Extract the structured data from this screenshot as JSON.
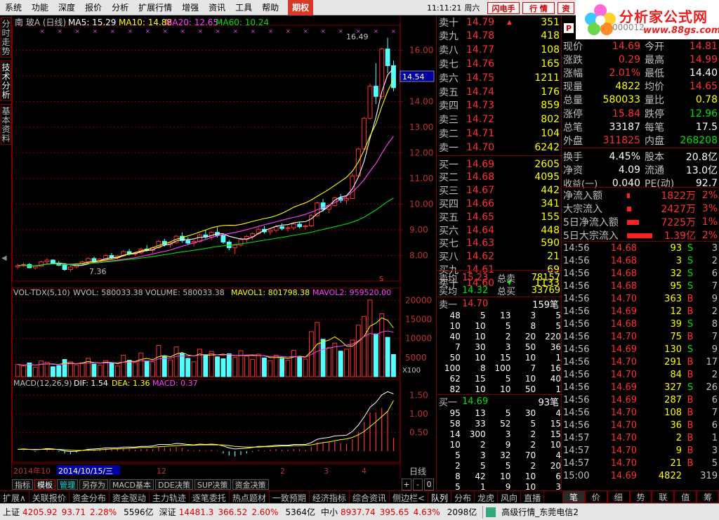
{
  "menubar": {
    "items": [
      "系统",
      "功能",
      "深度",
      "报价",
      "分析",
      "扩展行情",
      "增强",
      "资讯",
      "工具",
      "帮助"
    ],
    "highlight": "期权",
    "time": "11:11:21",
    "weekday": "周六",
    "btn_flash": "闪电手",
    "btn_quote": "行 情",
    "btn_info": "资"
  },
  "logo": {
    "title": "分析家公式网",
    "url": "www.88gs.com",
    "flag": "P",
    "code": "000012"
  },
  "sidebar": {
    "tabs": [
      "分时走势",
      "技术分析",
      "基本资料"
    ]
  },
  "chart": {
    "header": {
      "name": "南 玻A (日线)",
      "ma5": "MA5: 15.29",
      "ma10": "MA10: 14.88",
      "ma20": "MA20: 12.65",
      "ma60": "MA60: 10.24"
    },
    "vol_header": {
      "name": "VOL-TDX(5,10)",
      "wvol": "WVOL: 580033.38",
      "volume": "VOLUME: 580033.38",
      "mavol1": "MAVOL1: 801798.38",
      "mavol2": "MAVOL2: 959520.00"
    },
    "macd_header": {
      "name": "MACD(12,26,9)",
      "dif": "DIF: 1.54",
      "dea": "DEA: 1.36",
      "macd": "MACD: 0.37"
    },
    "price_ticks": [
      "16.00",
      "15.00",
      "14.00",
      "13.00",
      "12.00",
      "11.00",
      "10.00",
      "9.00",
      "8.00"
    ],
    "vol_ticks": [
      "20000",
      "15000",
      "10000",
      "5000"
    ],
    "macd_ticks": [
      "1.50",
      "1.00",
      "0.50"
    ],
    "current_price": "14.54",
    "high_label": "16.49",
    "low_label": "7.36",
    "vol_unit": "X100",
    "date_labels": [
      "2014年10",
      "2014/10/15/三",
      "12",
      "2",
      "3",
      "4"
    ],
    "period": "日线",
    "s_mark": "S"
  },
  "chart_data": {
    "type": "candlestick",
    "price_range": [
      7.0,
      16.7
    ],
    "candles": [
      [
        7.55,
        7.68,
        7.48,
        7.6
      ],
      [
        7.6,
        7.72,
        7.55,
        7.65
      ],
      [
        7.65,
        7.7,
        7.5,
        7.52
      ],
      [
        7.52,
        7.62,
        7.45,
        7.58
      ],
      [
        7.58,
        7.8,
        7.55,
        7.75
      ],
      [
        7.75,
        7.9,
        7.68,
        7.82
      ],
      [
        7.82,
        7.85,
        7.65,
        7.7
      ],
      [
        7.7,
        7.78,
        7.58,
        7.62
      ],
      [
        7.62,
        7.7,
        7.4,
        7.45
      ],
      [
        7.45,
        7.6,
        7.36,
        7.55
      ],
      [
        7.55,
        7.7,
        7.5,
        7.66
      ],
      [
        7.66,
        7.8,
        7.6,
        7.75
      ],
      [
        7.75,
        7.92,
        7.7,
        7.88
      ],
      [
        7.88,
        7.95,
        7.72,
        7.78
      ],
      [
        7.78,
        7.9,
        7.74,
        7.86
      ],
      [
        7.86,
        8.05,
        7.82,
        8.0
      ],
      [
        8.0,
        8.1,
        7.86,
        7.92
      ],
      [
        7.92,
        8.02,
        7.85,
        7.98
      ],
      [
        7.98,
        8.2,
        7.95,
        8.15
      ],
      [
        8.15,
        8.25,
        8.0,
        8.05
      ],
      [
        8.05,
        8.15,
        7.98,
        8.1
      ],
      [
        8.1,
        8.3,
        8.05,
        8.25
      ],
      [
        8.25,
        8.4,
        8.15,
        8.2
      ],
      [
        8.2,
        8.35,
        8.1,
        8.3
      ],
      [
        8.3,
        8.6,
        8.25,
        8.55
      ],
      [
        8.55,
        8.65,
        8.35,
        8.42
      ],
      [
        8.42,
        8.55,
        8.3,
        8.5
      ],
      [
        8.5,
        8.8,
        8.45,
        8.75
      ],
      [
        8.75,
        8.9,
        8.5,
        8.58
      ],
      [
        8.58,
        8.7,
        8.4,
        8.48
      ],
      [
        8.48,
        8.62,
        8.35,
        8.55
      ],
      [
        8.55,
        8.85,
        8.5,
        8.8
      ],
      [
        8.8,
        9.0,
        8.65,
        8.72
      ],
      [
        8.72,
        8.95,
        8.6,
        8.9
      ],
      [
        8.9,
        9.1,
        8.7,
        8.78
      ],
      [
        8.78,
        8.85,
        8.45,
        8.52
      ],
      [
        8.52,
        8.6,
        8.2,
        8.3
      ],
      [
        8.3,
        8.45,
        8.05,
        8.4
      ],
      [
        8.4,
        8.7,
        8.35,
        8.62
      ],
      [
        8.62,
        8.8,
        8.5,
        8.74
      ],
      [
        8.74,
        8.9,
        8.6,
        8.85
      ],
      [
        8.85,
        9.1,
        8.8,
        9.02
      ],
      [
        9.02,
        9.15,
        8.85,
        8.92
      ],
      [
        8.92,
        9.05,
        8.8,
        8.98
      ],
      [
        8.98,
        9.2,
        8.9,
        9.12
      ],
      [
        9.12,
        9.25,
        8.98,
        9.05
      ],
      [
        9.05,
        9.15,
        8.92,
        9.08
      ],
      [
        9.08,
        9.3,
        9.0,
        9.22
      ],
      [
        9.22,
        9.3,
        9.05,
        9.12
      ],
      [
        9.12,
        9.2,
        9.0,
        9.15
      ],
      [
        9.15,
        9.6,
        9.1,
        9.55
      ],
      [
        9.55,
        10.1,
        9.5,
        10.05
      ],
      [
        10.05,
        10.2,
        9.7,
        9.8
      ],
      [
        9.8,
        10.0,
        9.65,
        9.95
      ],
      [
        9.95,
        10.3,
        9.9,
        10.25
      ],
      [
        10.25,
        10.4,
        10.05,
        10.15
      ],
      [
        10.15,
        10.3,
        10.0,
        10.22
      ],
      [
        10.22,
        11.2,
        10.2,
        11.1
      ],
      [
        11.1,
        12.2,
        11.05,
        12.15
      ],
      [
        12.15,
        13.4,
        12.1,
        13.35
      ],
      [
        13.35,
        14.7,
        13.3,
        14.6
      ],
      [
        14.6,
        15.5,
        13.9,
        14.2
      ],
      [
        14.2,
        16.1,
        14.1,
        16.05
      ],
      [
        16.05,
        16.49,
        15.1,
        15.4
      ],
      [
        15.4,
        15.6,
        14.4,
        14.54
      ]
    ],
    "ma_series": [
      {
        "name": "MA5",
        "value": 15.29,
        "color": "#ffffff"
      },
      {
        "name": "MA10",
        "value": 14.88,
        "color": "#ffff00"
      },
      {
        "name": "MA20",
        "value": 12.65,
        "color": "#ff40ff"
      },
      {
        "name": "MA60",
        "value": 10.24,
        "color": "#00e000"
      }
    ],
    "vol_range": [
      0,
      21000
    ],
    "volume": [
      3200,
      2800,
      3600,
      2500,
      4100,
      3800,
      2600,
      2900,
      4500,
      3900,
      3100,
      3600,
      4800,
      3300,
      3000,
      4200,
      3500,
      2800,
      5600,
      4300,
      3700,
      6200,
      4100,
      3900,
      8200,
      5300,
      4400,
      7800,
      6100,
      4800,
      3900,
      7200,
      5800,
      6600,
      5200,
      4700,
      6000,
      5100,
      6800,
      5400,
      4500,
      5900,
      4900,
      4200,
      5600,
      4800,
      4300,
      6900,
      5200,
      4600,
      11800,
      14200,
      9800,
      7600,
      8800,
      6700,
      7200,
      9600,
      13500,
      15800,
      20100,
      11200,
      16500,
      10300,
      5800
    ],
    "macd_range": [
      -0.3,
      1.7
    ],
    "dif": [
      0.05,
      0.06,
      0.05,
      0.04,
      0.05,
      0.07,
      0.06,
      0.04,
      0.01,
      -0.01,
      0.0,
      0.02,
      0.05,
      0.06,
      0.07,
      0.09,
      0.09,
      0.09,
      0.11,
      0.11,
      0.11,
      0.13,
      0.13,
      0.14,
      0.18,
      0.18,
      0.18,
      0.21,
      0.2,
      0.18,
      0.17,
      0.19,
      0.18,
      0.19,
      0.18,
      0.14,
      0.09,
      0.06,
      0.07,
      0.08,
      0.1,
      0.13,
      0.13,
      0.14,
      0.16,
      0.16,
      0.16,
      0.18,
      0.18,
      0.18,
      0.23,
      0.32,
      0.35,
      0.37,
      0.41,
      0.42,
      0.43,
      0.53,
      0.7,
      0.92,
      1.18,
      1.31,
      1.51,
      1.6,
      1.54
    ],
    "dea": [
      0.05,
      0.05,
      0.05,
      0.05,
      0.05,
      0.05,
      0.05,
      0.05,
      0.04,
      0.03,
      0.02,
      0.02,
      0.03,
      0.03,
      0.04,
      0.05,
      0.06,
      0.06,
      0.07,
      0.08,
      0.09,
      0.1,
      0.1,
      0.11,
      0.12,
      0.13,
      0.14,
      0.15,
      0.16,
      0.16,
      0.16,
      0.17,
      0.17,
      0.17,
      0.17,
      0.17,
      0.15,
      0.13,
      0.12,
      0.11,
      0.11,
      0.11,
      0.12,
      0.12,
      0.13,
      0.14,
      0.14,
      0.15,
      0.15,
      0.16,
      0.17,
      0.2,
      0.23,
      0.25,
      0.28,
      0.31,
      0.33,
      0.37,
      0.44,
      0.53,
      0.66,
      0.79,
      0.93,
      1.07,
      1.36
    ]
  },
  "orderbook": {
    "sell": [
      [
        "卖十",
        "14.79",
        "351",
        "up"
      ],
      [
        "卖九",
        "14.78",
        "418",
        ""
      ],
      [
        "卖八",
        "14.77",
        "108",
        ""
      ],
      [
        "卖七",
        "14.76",
        "165",
        ""
      ],
      [
        "卖六",
        "14.75",
        "1211",
        ""
      ],
      [
        "卖五",
        "14.74",
        "176",
        ""
      ],
      [
        "卖四",
        "14.73",
        "859",
        ""
      ],
      [
        "卖三",
        "14.72",
        "802",
        ""
      ],
      [
        "卖二",
        "14.71",
        "104",
        ""
      ],
      [
        "卖一",
        "14.70",
        "6242",
        ""
      ]
    ],
    "buy": [
      [
        "买一",
        "14.69",
        "2605",
        ""
      ],
      [
        "买二",
        "14.68",
        "4095",
        ""
      ],
      [
        "买三",
        "14.67",
        "442",
        ""
      ],
      [
        "买四",
        "14.66",
        "341",
        ""
      ],
      [
        "买五",
        "14.65",
        "155",
        ""
      ],
      [
        "买六",
        "14.64",
        "448",
        ""
      ],
      [
        "买七",
        "14.63",
        "590",
        ""
      ],
      [
        "买八",
        "14.62",
        "21",
        ""
      ],
      [
        "买九",
        "14.61",
        "69",
        ""
      ],
      [
        "买十",
        "14.60",
        "1133",
        "down"
      ]
    ],
    "avg": {
      "sell_avg_label": "卖均",
      "sell_avg": "15.23",
      "sell_total_label": "总卖",
      "sell_total": "78157",
      "buy_avg_label": "买均",
      "buy_avg": "14.32",
      "buy_total_label": "总买",
      "buy_total": "33769"
    },
    "queue_sell": {
      "label": "卖一",
      "price": "14.70",
      "count": "159笔",
      "rows": [
        [
          "48",
          "5",
          "13",
          "3",
          "5"
        ],
        [
          "10",
          "10",
          "5",
          "8",
          "5"
        ],
        [
          "40",
          "10",
          "2",
          "20",
          "220"
        ],
        [
          "7",
          "30",
          "3",
          "50",
          "36"
        ],
        [
          "50",
          "10",
          "15",
          "10",
          "1"
        ],
        [
          "100",
          "8",
          "100",
          "7",
          "16"
        ],
        [
          "62",
          "15",
          "5",
          "10",
          "40"
        ],
        [
          "82",
          "10",
          "10",
          "50",
          "1"
        ]
      ]
    },
    "queue_buy": {
      "label": "买一",
      "price": "14.69",
      "count": "93笔",
      "rows": [
        [
          "95",
          "13",
          "5",
          "30",
          "4"
        ],
        [
          "58",
          "33",
          "52",
          "5",
          "15"
        ],
        [
          "14",
          "300",
          "3",
          "2",
          "15"
        ],
        [
          "10",
          "2",
          "9",
          "2",
          "10"
        ],
        [
          "5",
          "3",
          "32",
          "70",
          "4"
        ],
        [
          "2",
          "5",
          "5",
          "2",
          "20"
        ],
        [
          "8",
          "42",
          "10",
          "10",
          "6"
        ],
        [
          "5",
          "1",
          "9",
          "10",
          "3"
        ]
      ]
    }
  },
  "quote": {
    "rows": [
      {
        "l1": "现价",
        "v1": "14.69",
        "c1": "red",
        "l2": "今开",
        "v2": "14.81",
        "c2": "red"
      },
      {
        "l1": "涨跌",
        "v1": "0.29",
        "c1": "red",
        "l2": "最高",
        "v2": "14.99",
        "c2": "red"
      },
      {
        "l1": "涨幅",
        "v1": "2.01%",
        "c1": "red",
        "l2": "最低",
        "v2": "14.40",
        "c2": "white"
      },
      {
        "l1": "现量",
        "v1": "4822",
        "c1": "yellow",
        "l2": "均价",
        "v2": "14.65",
        "c2": "red"
      },
      {
        "l1": "总量",
        "v1": "580033",
        "c1": "yellow",
        "l2": "量比",
        "v2": "0.78",
        "c2": "yellow"
      },
      {
        "l1": "涨停",
        "v1": "15.84",
        "c1": "red",
        "l2": "跌停",
        "v2": "12.96",
        "c2": "green"
      },
      {
        "l1": "总笔",
        "v1": "33187",
        "c1": "white",
        "l2": "每笔",
        "v2": "17.5",
        "c2": "white"
      },
      {
        "l1": "外盘",
        "v1": "311825",
        "c1": "red",
        "l2": "内盘",
        "v2": "268208",
        "c2": "green"
      },
      {
        "l1": "换手",
        "v1": "4.45%",
        "c1": "white",
        "l2": "股本",
        "v2": "20.8亿",
        "c2": "white"
      },
      {
        "l1": "净资",
        "v1": "4.09",
        "c1": "white",
        "l2": "流通",
        "v2": "13.0亿",
        "c2": "white"
      },
      {
        "l1": "收益(一)",
        "v1": "0.040",
        "c1": "white",
        "l2": "PE(动)",
        "v2": "92.7",
        "c2": "white"
      }
    ],
    "flows": [
      {
        "label": "净流入额",
        "value": "1822万",
        "pct": "2%",
        "bar": 0.1
      },
      {
        "label": "大宗流入",
        "value": "2427万",
        "pct": "3%",
        "bar": 0.15
      },
      {
        "label": "5日净流入额",
        "value": "7225万",
        "pct": "1%",
        "bar": 0.45
      },
      {
        "label": "5日大宗流入",
        "value": "1.39亿",
        "pct": "2%",
        "bar": 0.95
      }
    ],
    "ticks": [
      [
        "14:56",
        "14.68",
        "93",
        "S",
        "3"
      ],
      [
        "14:56",
        "14.68",
        "3",
        "S",
        "2"
      ],
      [
        "14:56",
        "14.68",
        "32",
        "S",
        "6"
      ],
      [
        "14:56",
        "14.68",
        "95",
        "S",
        "7"
      ],
      [
        "14:56",
        "14.70",
        "363",
        "B",
        "9"
      ],
      [
        "14:56",
        "14.69",
        "12",
        "B",
        "2"
      ],
      [
        "14:56",
        "14.68",
        "39",
        "S",
        "8"
      ],
      [
        "14:56",
        "14.70",
        "75",
        "B",
        "7"
      ],
      [
        "14:56",
        "14.69",
        "130",
        "S",
        "9"
      ],
      [
        "14:56",
        "14.70",
        "291",
        "B",
        "17"
      ],
      [
        "14:56",
        "14.70",
        "84",
        "B",
        "2"
      ],
      [
        "14:56",
        "14.69",
        "327",
        "S",
        "26"
      ],
      [
        "14:56",
        "14.69",
        "287",
        "B",
        "6"
      ],
      [
        "14:56",
        "14.70",
        "108",
        "B",
        "7"
      ],
      [
        "14:56",
        "14.70",
        "36",
        "B",
        "6"
      ],
      [
        "14:57",
        "14.70",
        "2",
        "B",
        "1"
      ],
      [
        "14:57",
        "14.70",
        "9",
        "B",
        "3"
      ],
      [
        "14:57",
        "14.70",
        "21",
        "B",
        "5"
      ],
      [
        "15:00",
        "14.69",
        "4822",
        "",
        "319"
      ]
    ],
    "tabs": [
      "笔",
      "价",
      "细",
      "势",
      "联",
      "值",
      "筹"
    ]
  },
  "bottom_tabs": [
    "指标",
    "模板",
    "管理",
    "另存为",
    "MACD基本",
    "DDE决策",
    "SUP决策",
    "资金决策"
  ],
  "funcbar": [
    "扩展∧",
    "关联报价",
    "资金分布",
    "资金驱动",
    "主力轨迹",
    "逐笔委托",
    "热点题材",
    "一致预期",
    "经济指标",
    "综合资讯",
    "侧边栏<",
    "队列",
    "分布",
    "龙虎",
    "风向",
    "直播"
  ],
  "status": {
    "sh_label": "上证",
    "sh_index": "4205.92",
    "sh_chg": "93.71",
    "sh_pct": "2.28%",
    "sh_amt": "5596亿",
    "sz_label": "深证",
    "sz_index": "14481.3",
    "sz_chg": "366.52",
    "sz_pct": "2.60%",
    "sz_amt": "5364亿",
    "zx_label": "中小",
    "zx_index": "8937.74",
    "zx_chg": "395.65",
    "zx_pct": "4.63%",
    "zx_amt": "2098亿",
    "server": "高级行情_东莞电信2"
  }
}
